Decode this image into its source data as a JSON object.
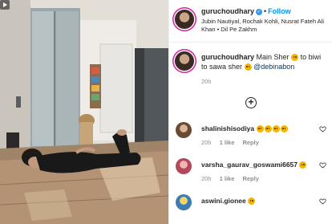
{
  "post": {
    "username": "guruchoudhary",
    "follow_label": "Follow",
    "audio": "Jubin Nautiyal, Rochak Kohli, Nusrat Fateh Ali Khan • Dil Pe Zakhm"
  },
  "caption": {
    "username": "guruchoudhary",
    "text_a": "Main Sher",
    "text_b": "to biwi to sawa sher",
    "mention": "@debinabon",
    "time": "20h"
  },
  "comments": [
    {
      "username": "shalinishisodiya",
      "text": "",
      "emoji_count": 4,
      "time": "20h",
      "likes": "1 like",
      "reply": "Reply"
    },
    {
      "username": "varsha_gaurav_goswami6657",
      "text": "",
      "emoji_count": 1,
      "time": "20h",
      "likes": "1 like",
      "reply": "Reply"
    },
    {
      "username": "aswini.gionee",
      "text": "",
      "emoji_count": 1,
      "time": "",
      "likes": "",
      "reply": ""
    }
  ],
  "icons": {
    "verified": "verified-badge-icon",
    "heart": "heart-icon",
    "plus": "plus-circle-icon",
    "play": "play-icon"
  },
  "colors": {
    "link_blue": "#0095f6",
    "mention_blue": "#00376b",
    "muted": "#8e8e8e",
    "text": "#262626"
  }
}
